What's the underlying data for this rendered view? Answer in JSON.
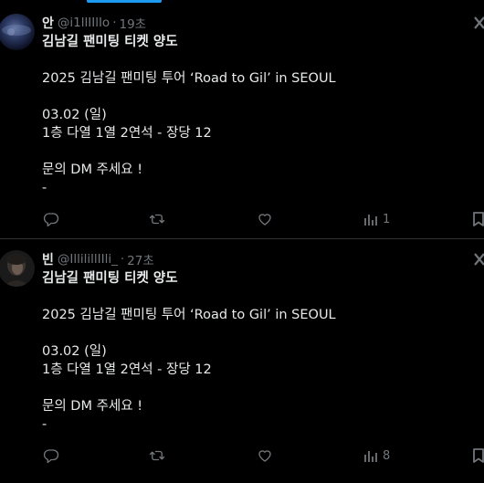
{
  "tweets": [
    {
      "name": "안",
      "handle": "@i1llIIlIo",
      "separator": "·",
      "time": "19초",
      "lines": [
        "김남길 팬미팅 티켓 양도",
        "",
        "2025 김남길 팬미팅 투어 ‘Road to Gil’ in SEOUL",
        "",
        "03.02 (일)",
        "1층 다열 1열 2연석 - 장당 12",
        "",
        "문의 DM 주세요 !",
        "-"
      ],
      "actions": {
        "reply_icon": "reply-icon",
        "retweet_icon": "retweet-icon",
        "like_icon": "heart-icon",
        "views_icon": "views-icon",
        "views_count": "1",
        "bookmark_icon": "bookmark-icon"
      }
    },
    {
      "name": "빈",
      "handle": "@IllilillIIli_",
      "separator": "·",
      "time": "27초",
      "lines": [
        "김남길 팬미팅 티켓 양도",
        "",
        "2025 김남길 팬미팅 투어 ‘Road to Gil’ in SEOUL",
        "",
        "03.02 (일)",
        "1층 다열 1열 2연석 - 장당 12",
        "",
        "문의 DM 주세요 !",
        "-"
      ],
      "actions": {
        "reply_icon": "reply-icon",
        "retweet_icon": "retweet-icon",
        "like_icon": "heart-icon",
        "views_icon": "views-icon",
        "views_count": "8",
        "bookmark_icon": "bookmark-icon"
      }
    }
  ],
  "colors": {
    "background": "#000000",
    "text_primary": "#e7e9ea",
    "text_secondary": "#71767b",
    "divider": "#2f3336",
    "accent": "#1d9bf0"
  }
}
